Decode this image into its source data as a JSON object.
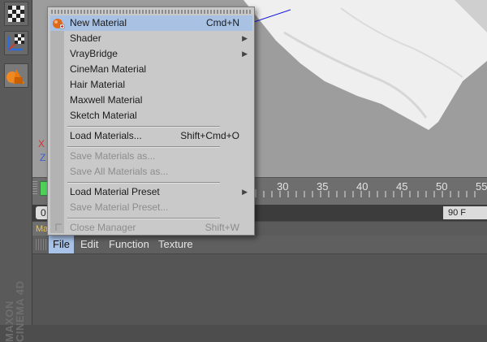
{
  "viewport": {
    "axis_x": "X",
    "axis_z": "Z"
  },
  "timeline": {
    "ticks": [
      "30",
      "35",
      "40",
      "45",
      "50",
      "55"
    ],
    "start_frame": "0",
    "end_frame": "90 F"
  },
  "material_manager": {
    "tab_label": "Ma",
    "menus": [
      "File",
      "Edit",
      "Function",
      "Texture"
    ],
    "active_menu": "File"
  },
  "branding": {
    "line1": "MAXON",
    "line2": "CINEMA 4D"
  },
  "file_menu": {
    "items": [
      {
        "label": "New Material",
        "shortcut": "Cmd+N",
        "highlighted": true
      },
      {
        "label": "Shader",
        "submenu": true
      },
      {
        "label": "VrayBridge",
        "submenu": true
      },
      {
        "label": "CineMan Material"
      },
      {
        "label": "Hair Material"
      },
      {
        "label": "Maxwell Material"
      },
      {
        "label": "Sketch Material"
      },
      {
        "label": "Load Materials...",
        "shortcut": "Shift+Cmd+O"
      },
      {
        "label": "Save Materials as...",
        "disabled": true
      },
      {
        "label": "Save All Materials as...",
        "disabled": true
      },
      {
        "label": "Load Material Preset",
        "submenu": true
      },
      {
        "label": "Save Material Preset...",
        "disabled": true
      },
      {
        "label": "Close Manager",
        "shortcut": "Shift+W",
        "disabled": true
      }
    ]
  },
  "colors": {
    "highlight": "#a9c1e2",
    "menu_bg": "#c9c9c9",
    "timeline_handle": "#4fd15a",
    "tab_text": "#f0c84a"
  }
}
